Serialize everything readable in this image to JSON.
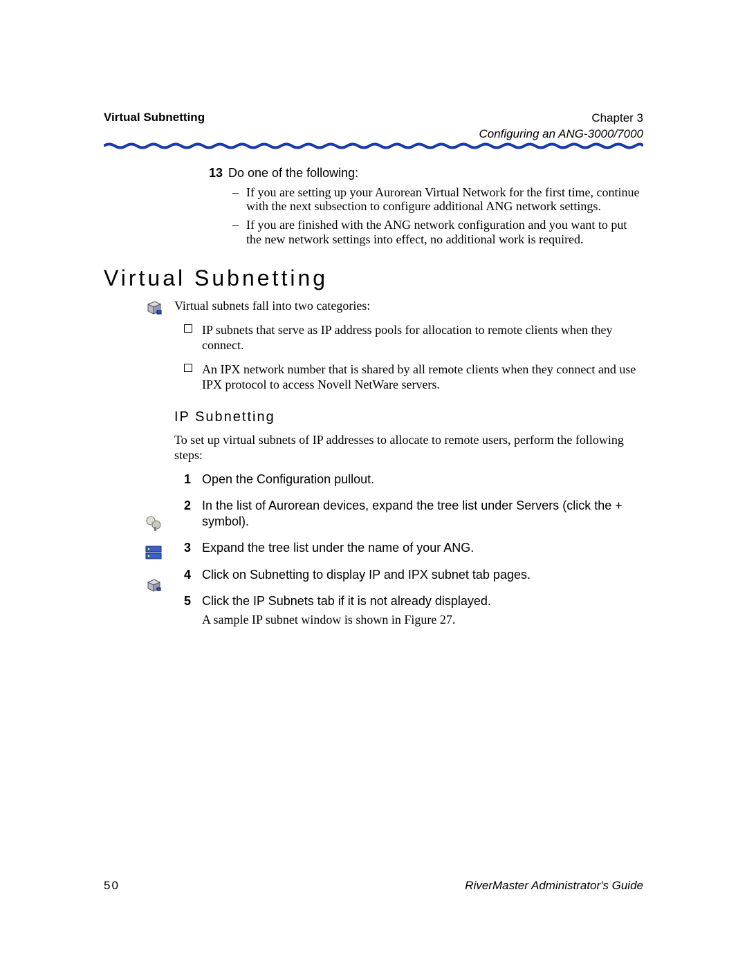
{
  "header": {
    "left": "Virtual Subnetting",
    "chapter": "Chapter 3",
    "subtitle": "Configuring an ANG-3000/7000"
  },
  "step13": {
    "num": "13",
    "lead": "Do one of the following:",
    "items": [
      "If you are setting up your Aurorean Virtual Network for the first time, continue with the next subsection to configure additional ANG network settings.",
      "If you are finished with the ANG network configuration and you want to put the new network settings into effect, no additional work is required."
    ]
  },
  "h1": "Virtual Subnetting",
  "intro": "Virtual subnets fall into two categories:",
  "checks": [
    "IP subnets that serve as IP address pools for allocation to remote clients when they connect.",
    "An IPX network number that is shared by all remote clients when they connect and use IPX protocol to access Novell NetWare servers."
  ],
  "h2": "IP Subnetting",
  "h2_intro": "To set up virtual subnets of IP addresses to allocate to remote users, perform the following steps:",
  "steps": [
    {
      "n": "1",
      "t": "Open the Configuration pullout."
    },
    {
      "n": "2",
      "t": "In the list of Aurorean devices, expand the tree list under Servers (click the + symbol)."
    },
    {
      "n": "3",
      "t": "Expand the tree list under the name of your ANG."
    },
    {
      "n": "4",
      "t": "Click on Subnetting to display IP and IPX subnet tab pages."
    },
    {
      "n": "5",
      "t": "Click the IP Subnets tab if it is not already displayed.",
      "after": "A sample IP subnet window is shown in Figure 27."
    }
  ],
  "footer": {
    "page": "50",
    "guide": "RiverMaster Administrator's Guide"
  }
}
